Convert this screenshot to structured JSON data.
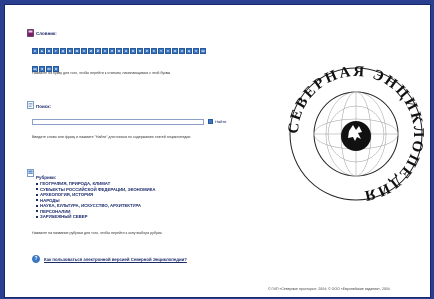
{
  "alphabet": {
    "title": "Словник:",
    "letters": [
      "А",
      "Б",
      "В",
      "Г",
      "Д",
      "Е",
      "Ж",
      "З",
      "И",
      "Й",
      "К",
      "Л",
      "М",
      "Н",
      "О",
      "П",
      "Р",
      "С",
      "Т",
      "У",
      "Ф",
      "Х",
      "Ц",
      "Ч",
      "Ш",
      "Щ",
      "Э",
      "Ю",
      "Я"
    ],
    "hint": "Нажмите на букву для того, чтобы перейти к статьям, начинающимся с этой буквы"
  },
  "search": {
    "title": "Поиск:",
    "value": "",
    "button_label": "Найти",
    "hint": "Введите слово или фразу и нажмите \"Найти\" для поиска по содержанию статей энциклопедии"
  },
  "rubrics": {
    "title": "Рубрики:",
    "items": [
      "ГЕОГРАФИЯ, ПРИРОДА, КЛИМАТ",
      "СУБЪЕКТЫ РОССИЙСКОЙ ФЕДЕРАЦИИ, ЭКОНОМИКА",
      "АРХЕОЛОГИЯ, ИСТОРИЯ",
      "НАРОДЫ",
      "НАУКА, КУЛЬТУРА, ИСКУССТВО, АРХИТЕКТУРА",
      "ПЕРСОНАЛИИ",
      "ЗАРУБЕЖНЫЙ СЕВЕР"
    ],
    "hint": "Нажмите на название рубрики для того, чтобы перейти к окну выбора рубрик."
  },
  "help": {
    "link": "Как пользоваться электронной версией Северной Энциклопедии?"
  },
  "footer": {
    "text": "© ГИП «Северные просторы», 2004; © ООО «Европейские издания», 2004"
  },
  "logo": {
    "text": "СЕВЕРНАЯ ЭНЦИКЛОПЕДИЯ"
  },
  "colors": {
    "frame": "#2a3f8f",
    "accent": "#3b78c4",
    "text": "#1b2a6b"
  }
}
